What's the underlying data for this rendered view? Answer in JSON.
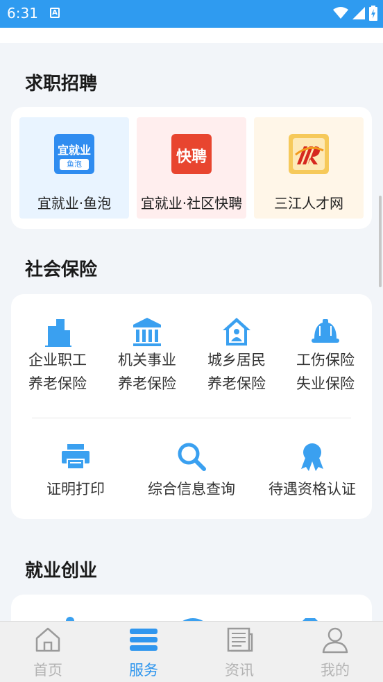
{
  "status": {
    "time": "6:31",
    "a_icon": "A"
  },
  "sections": {
    "recruit": "求职招聘",
    "insurance": "社会保险",
    "employment": "就业创业"
  },
  "recruit": {
    "items": [
      {
        "label": "宜就业·鱼泡",
        "logo_text": "宜就业",
        "logo_sub": "鱼泡",
        "bg": "#e9f4ff"
      },
      {
        "label": "宜就业·社区快聘",
        "logo_text": "快聘",
        "bg": "#ffeeee"
      },
      {
        "label": "三江人才网",
        "bg": "#fff6e8"
      }
    ]
  },
  "insurance": {
    "row1": [
      {
        "line1": "企业职工",
        "line2": "养老保险",
        "icon": "buildings-icon"
      },
      {
        "line1": "机关事业",
        "line2": "养老保险",
        "icon": "institution-icon"
      },
      {
        "line1": "城乡居民",
        "line2": "养老保险",
        "icon": "house-person-icon"
      },
      {
        "line1": "工伤保险",
        "line2": "失业保险",
        "icon": "hardhat-icon"
      }
    ],
    "row2": [
      {
        "label": "证明打印",
        "icon": "printer-icon"
      },
      {
        "label": "综合信息查询",
        "icon": "search-icon"
      },
      {
        "label": "待遇资格认证",
        "icon": "award-ribbon-icon"
      }
    ]
  },
  "tabs": [
    {
      "label": "首页",
      "icon": "home-icon",
      "active": false
    },
    {
      "label": "服务",
      "icon": "stack-icon",
      "active": true
    },
    {
      "label": "资讯",
      "icon": "news-icon",
      "active": false
    },
    {
      "label": "我的",
      "icon": "user-icon",
      "active": false
    }
  ],
  "colors": {
    "status_bar": "#2f9bf0",
    "accent": "#2f96ee",
    "icon_blue": "#3aa0f0"
  }
}
